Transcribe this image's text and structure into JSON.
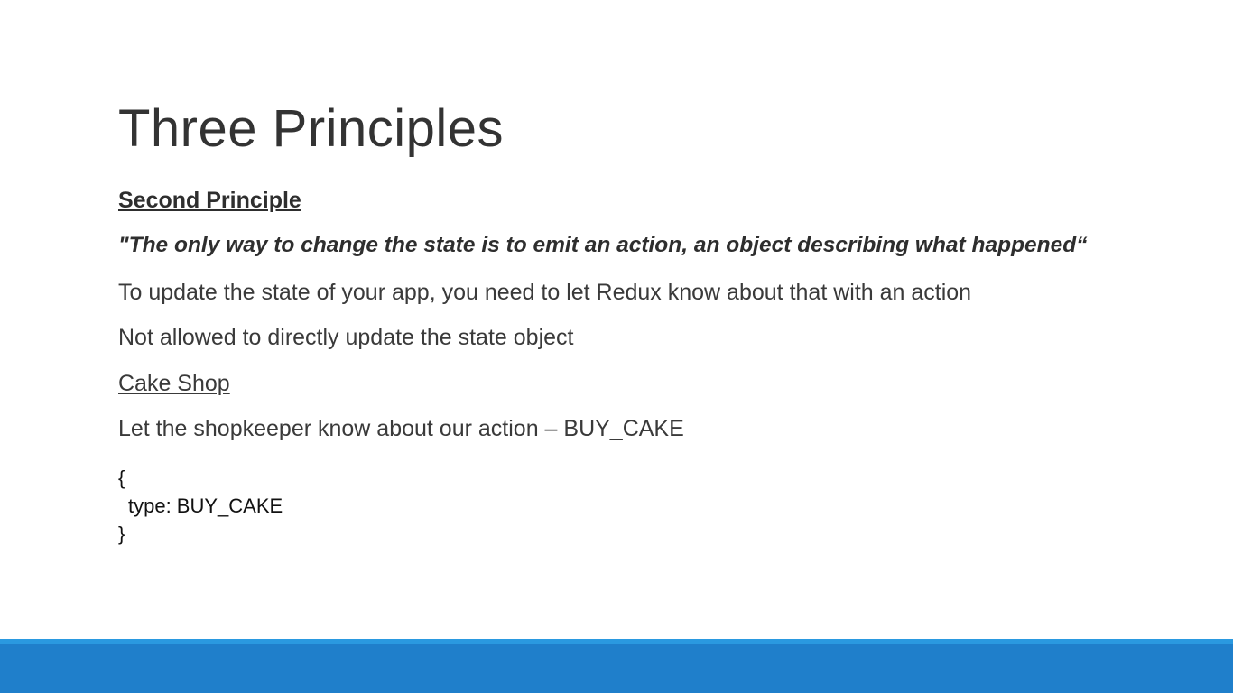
{
  "slide": {
    "title": "Three Principles",
    "section_heading": "Second Principle",
    "quote": "\"The only way to change the state is to emit an action, an object describing what happened“",
    "points": [
      "To update the state of your app, you need to let Redux know about that with an action",
      "Not allowed to directly update the state object"
    ],
    "subheading": "Cake Shop",
    "example_text": "Let the shopkeeper know about our action – BUY_CAKE",
    "code": {
      "open_brace": "{",
      "line": "type: BUY_CAKE",
      "close_brace": "}"
    }
  },
  "colors": {
    "footer_bar": "#1f7fcb",
    "footer_highlight": "#2a99e0",
    "title_text": "#333333",
    "body_text": "#3a3a3a"
  }
}
